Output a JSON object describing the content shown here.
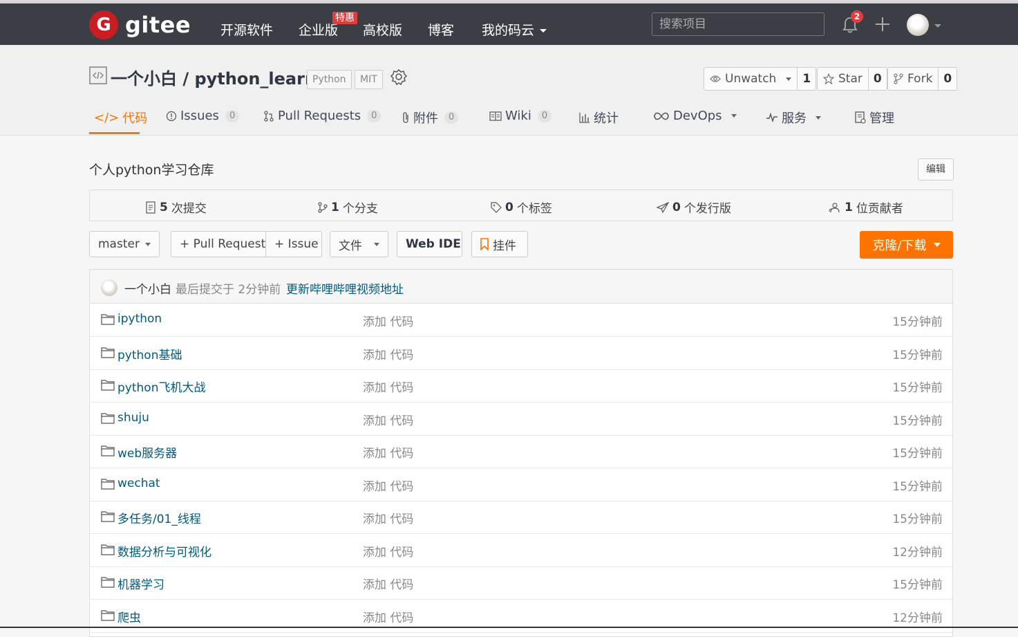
{
  "brand": {
    "logo_letter": "G",
    "name": "gitee"
  },
  "nav": {
    "items": [
      {
        "label": "开源软件"
      },
      {
        "label": "企业版"
      },
      {
        "label": "高校版"
      },
      {
        "label": "博客"
      },
      {
        "label": "我的码云"
      }
    ],
    "hot_badge": "特惠",
    "search_placeholder": "搜索项目",
    "notification_count": "2"
  },
  "repo": {
    "title": "一个小白 / python_learn",
    "tags": [
      "Python",
      "MIT"
    ],
    "watch": {
      "label": "Unwatch",
      "count": "1"
    },
    "star": {
      "label": "Star",
      "count": "0"
    },
    "fork": {
      "label": "Fork",
      "count": "0"
    },
    "description": "个人python学习仓库",
    "edit_label": "编辑"
  },
  "tabs": [
    {
      "label": "代码"
    },
    {
      "label": "Issues",
      "count": "0"
    },
    {
      "label": "Pull Requests",
      "count": "0"
    },
    {
      "label": "附件",
      "count": "0"
    },
    {
      "label": "Wiki",
      "count": "0"
    },
    {
      "label": "统计"
    },
    {
      "label": "DevOps"
    },
    {
      "label": "服务"
    },
    {
      "label": "管理"
    }
  ],
  "stats": [
    {
      "num": "5",
      "label": "次提交"
    },
    {
      "num": "1",
      "label": "个分支"
    },
    {
      "num": "0",
      "label": "个标签"
    },
    {
      "num": "0",
      "label": "个发行版"
    },
    {
      "num": "1",
      "label": "位贡献者"
    }
  ],
  "toolbar": {
    "branch": "master",
    "pull_request": "+ Pull Request",
    "issue": "+ Issue",
    "file": "文件",
    "web_ide": "Web IDE",
    "widget": "挂件",
    "clone": "克隆/下载"
  },
  "last_commit": {
    "author": "一个小白",
    "meta": "最后提交于 2分钟前",
    "message": "更新哔哩哔哩视频地址"
  },
  "files": [
    {
      "name": "ipython",
      "commit": "添加 代码",
      "time": "15分钟前"
    },
    {
      "name": "python基础",
      "commit": "添加 代码",
      "time": "15分钟前"
    },
    {
      "name": "python飞机大战",
      "commit": "添加 代码",
      "time": "15分钟前"
    },
    {
      "name": "shuju",
      "commit": "添加 代码",
      "time": "15分钟前"
    },
    {
      "name": "web服务器",
      "commit": "添加 代码",
      "time": "15分钟前"
    },
    {
      "name": "wechat",
      "commit": "添加 代码",
      "time": "15分钟前"
    },
    {
      "name": "多任务/01_线程",
      "commit": "添加 代码",
      "time": "15分钟前"
    },
    {
      "name": "数据分析与可视化",
      "commit": "添加 代码",
      "time": "12分钟前"
    },
    {
      "name": "机器学习",
      "commit": "添加 代码",
      "time": "15分钟前"
    },
    {
      "name": "爬虫",
      "commit": "添加 代码",
      "time": "12分钟前"
    }
  ],
  "colors": {
    "accent": "#fe7300",
    "topbar": "#3b3f45",
    "link": "#005980",
    "brand_red": "#c71d23"
  }
}
